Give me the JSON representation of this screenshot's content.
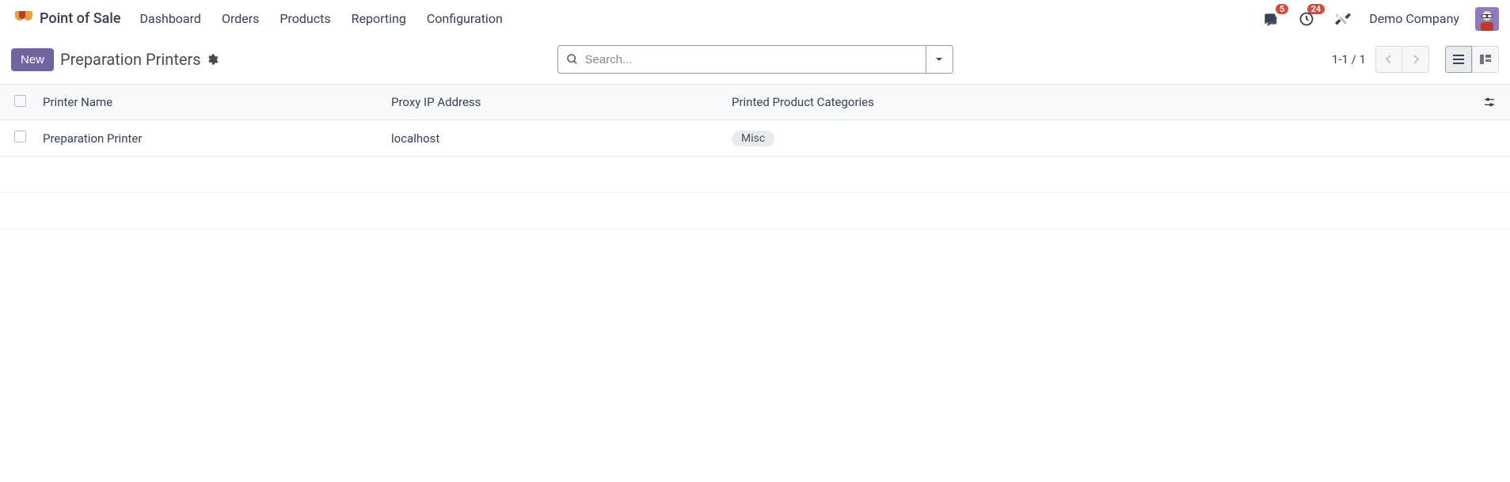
{
  "app": {
    "title": "Point of Sale"
  },
  "nav": {
    "items": [
      "Dashboard",
      "Orders",
      "Products",
      "Reporting",
      "Configuration"
    ]
  },
  "header_right": {
    "messages_badge": "5",
    "activities_badge": "24",
    "company": "Demo Company"
  },
  "control": {
    "new_label": "New",
    "breadcrumb": "Preparation Printers",
    "search_placeholder": "Search...",
    "pager": "1-1 / 1"
  },
  "table": {
    "headers": {
      "name": "Printer Name",
      "ip": "Proxy IP Address",
      "cat": "Printed Product Categories"
    },
    "rows": [
      {
        "name": "Preparation Printer",
        "ip": "localhost",
        "cat": "Misc"
      }
    ]
  }
}
